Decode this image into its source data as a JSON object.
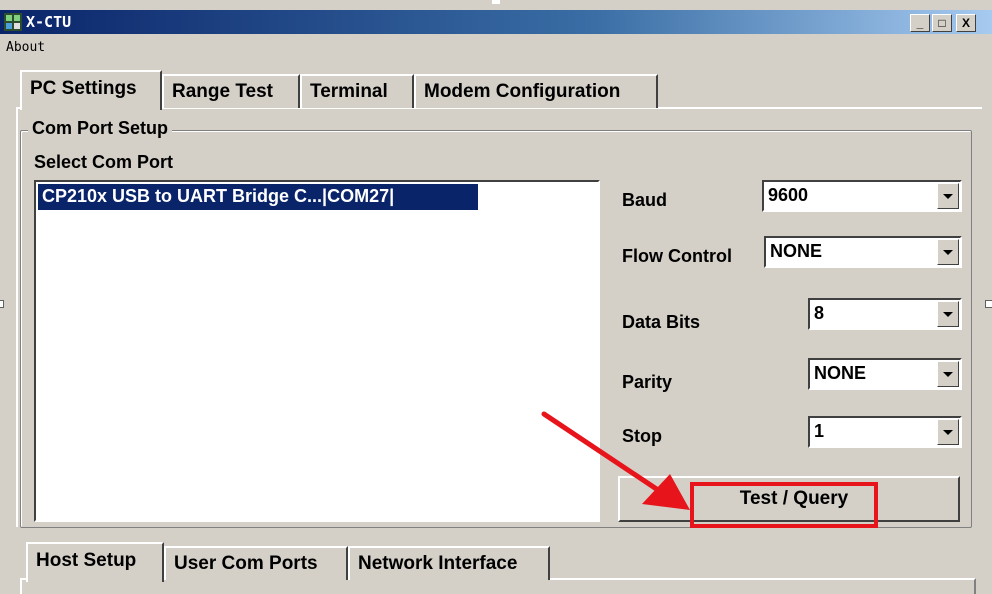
{
  "window": {
    "title": "X-CTU",
    "controls": {
      "minimize": "_",
      "maximize": "□",
      "close": "X"
    }
  },
  "menu": {
    "items": [
      "About"
    ]
  },
  "tabs": [
    {
      "label": "PC Settings",
      "active": true
    },
    {
      "label": "Range Test",
      "active": false
    },
    {
      "label": "Terminal",
      "active": false
    },
    {
      "label": "Modem Configuration",
      "active": false
    }
  ],
  "com_port_setup": {
    "group_title": "Com Port Setup",
    "select_label": "Select Com Port",
    "ports": [
      {
        "label": "CP210x USB to UART Bridge C...|COM27|",
        "selected": true
      }
    ]
  },
  "settings": {
    "baud": {
      "label": "Baud",
      "value": "9600"
    },
    "flow_control": {
      "label": "Flow Control",
      "value": "NONE"
    },
    "data_bits": {
      "label": "Data Bits",
      "value": "8"
    },
    "parity": {
      "label": "Parity",
      "value": "NONE"
    },
    "stop": {
      "label": "Stop",
      "value": "1"
    }
  },
  "test_button": {
    "label": "Test / Query"
  },
  "annotation": {
    "arrow_color": "#e8141b",
    "highlight_color": "#e8141b"
  },
  "bottom_tabs": [
    {
      "label": "Host Setup",
      "active": true
    },
    {
      "label": "User Com Ports",
      "active": false
    },
    {
      "label": "Network Interface",
      "active": false
    }
  ],
  "colors": {
    "titlebar": "#0a246a",
    "selection": "#0a246a",
    "face": "#d4d0c8"
  }
}
